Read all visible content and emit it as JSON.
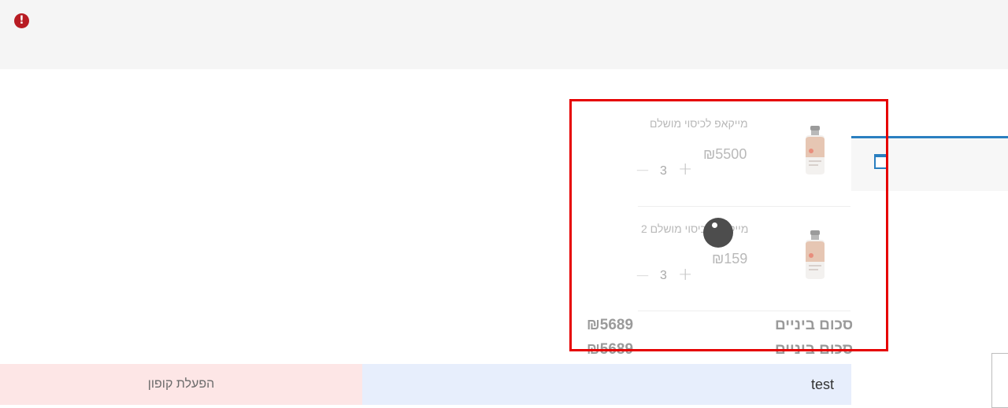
{
  "banner": {
    "icon": "exclamation-circle-icon",
    "icon_glyph": "!"
  },
  "cart": {
    "items": [
      {
        "name": "מייקאפ לכיסוי מושלם",
        "price": "₪5500",
        "quantity": "3",
        "minus": "—",
        "plus": "+",
        "image": "serum-bottle-icon"
      },
      {
        "name": "מייקאפ לכיסוי מושלם 2",
        "price": "₪159",
        "quantity": "3",
        "minus": "—",
        "plus": "+",
        "image": "serum-bottle-icon"
      }
    ],
    "subtotal_label": "סכום ביניים",
    "subtotal_value": "₪5689",
    "subtotal_label_2": "סכום ביניים",
    "subtotal_value_2": "₪5689"
  },
  "coupon": {
    "input_value": "test",
    "button_label": "הפעלת קופון"
  },
  "colors": {
    "accent": "#2a7fc0",
    "error": "#b81c23",
    "highlight": "#e60000",
    "coupon_input_bg": "#e7eefc",
    "coupon_button_bg": "#fde6e6"
  }
}
